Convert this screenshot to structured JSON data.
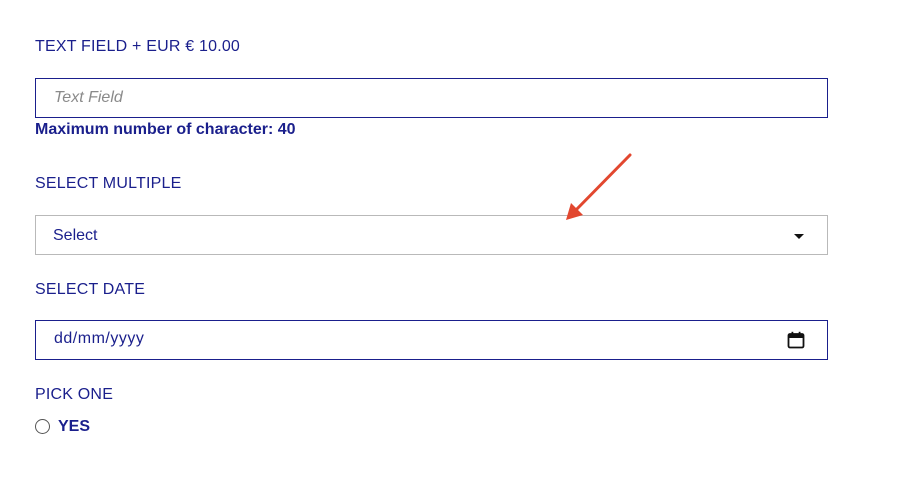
{
  "text_field": {
    "label": "TEXT FIELD + EUR € 10.00",
    "placeholder": "Text Field",
    "hint": "Maximum number of character: 40"
  },
  "select_multiple": {
    "label": "SELECT MULTIPLE",
    "value": "Select"
  },
  "select_date": {
    "label": "SELECT DATE",
    "value": "dd/mm/yyyy"
  },
  "pick_one": {
    "label": "PICK ONE",
    "options": [
      {
        "label": "YES"
      }
    ]
  },
  "annotation": {
    "arrow_color": "#e2472f"
  },
  "colors": {
    "text": "#1a1f8c",
    "border": "#1a1f8c",
    "select_border": "#b9b9b9"
  }
}
